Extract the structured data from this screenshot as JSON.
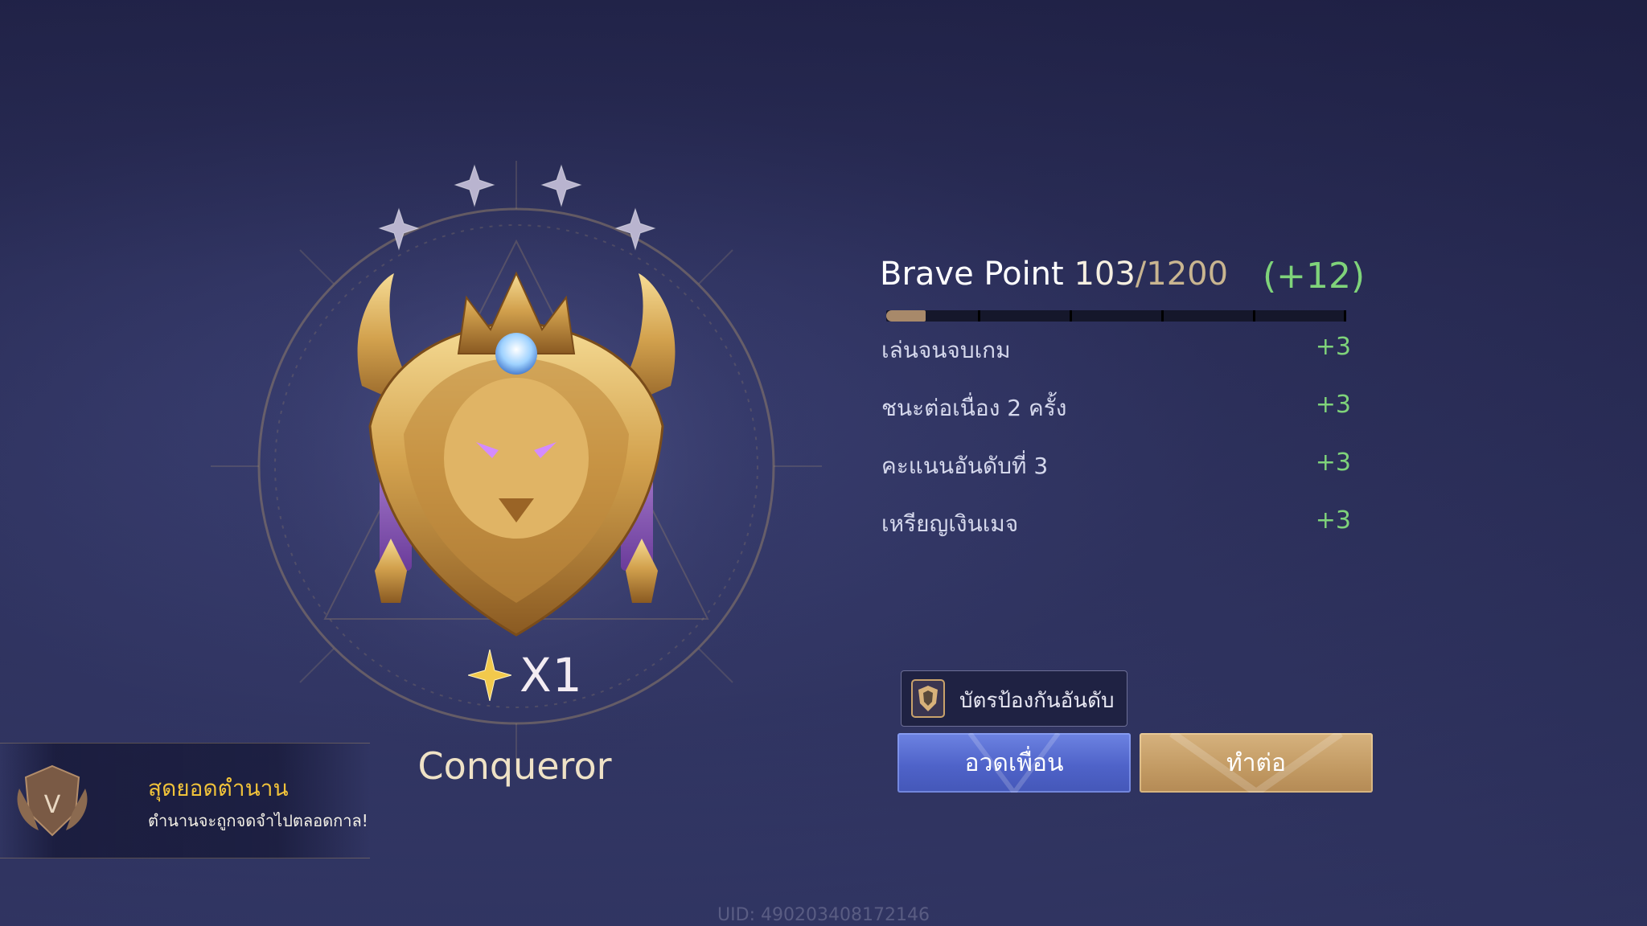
{
  "rank": {
    "name": "Conqueror",
    "star_count_text": "X1",
    "stars_filled": 0,
    "stars_total": 4
  },
  "legend": {
    "title": "สุดยอดตำนาน",
    "subtitle": "ตำนานจะถูกจดจำไปตลอดกาล!",
    "badge_letter": "V"
  },
  "brave_point": {
    "label": "Brave Point",
    "current": "103",
    "max": "/1200",
    "gain": "(+12)",
    "progress_fraction": 0.086,
    "rows": [
      {
        "label": "เล่นจนจบเกม",
        "value": "+3"
      },
      {
        "label": "ชนะต่อเนื่อง 2 ครั้ง",
        "value": "+3"
      },
      {
        "label": "คะแนนอันดับที่ 3",
        "value": "+3"
      },
      {
        "label": "เหรียญเงินเมจ",
        "value": "+3"
      }
    ]
  },
  "protect_card": {
    "label": "บัตรป้องกันอันดับ"
  },
  "buttons": {
    "brag_friends": "อวดเพื่อน",
    "continue": "ทำต่อ"
  },
  "uid": "UID: 490203408172146",
  "colors": {
    "accent_green": "#7fd37a",
    "gold": "#f0c23a",
    "button_blue": "#5a6fd4",
    "button_gold": "#c9a26b"
  }
}
